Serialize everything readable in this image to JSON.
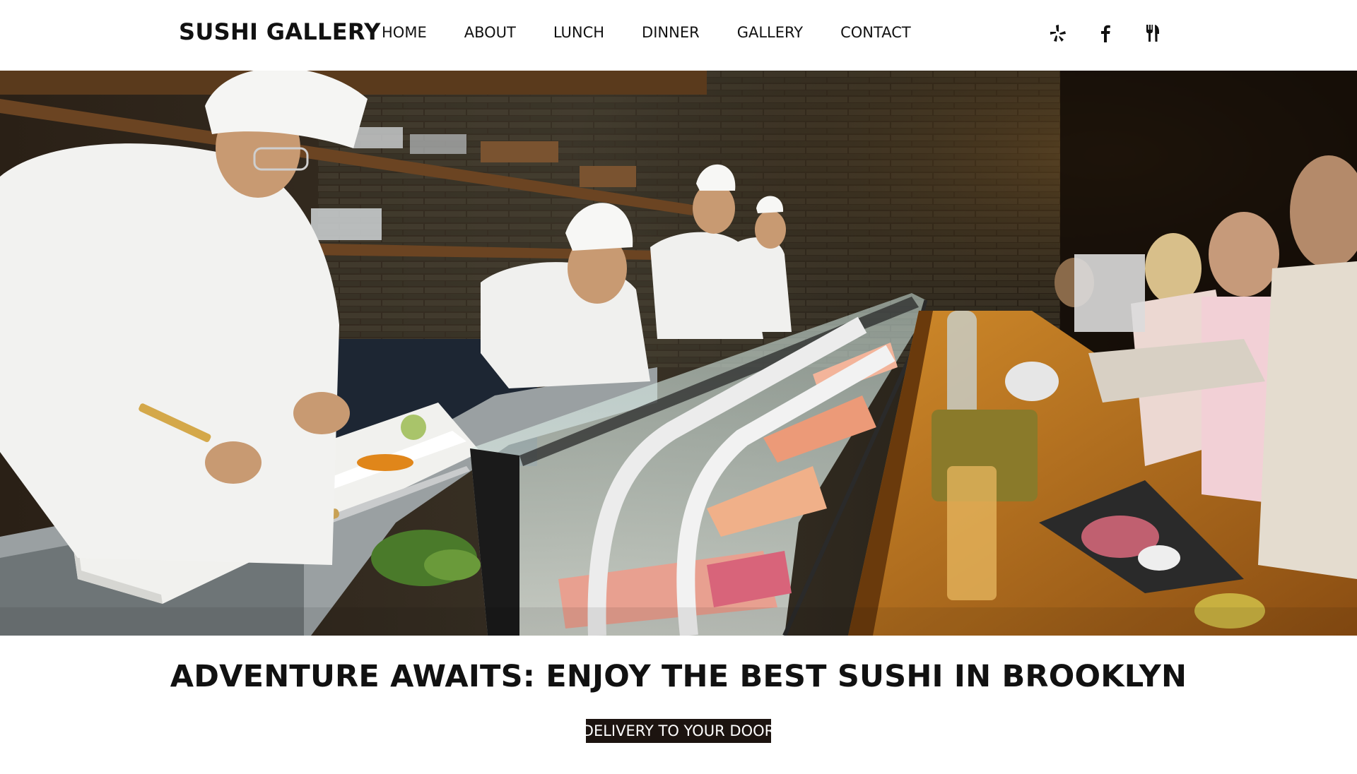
{
  "header": {
    "brand": "SUSHI GALLERY",
    "nav": [
      "HOME",
      "ABOUT",
      "LUNCH",
      "DINNER",
      "GALLERY",
      "CONTACT"
    ],
    "social_icons": [
      "yelp-icon",
      "facebook-icon",
      "fork-knife-icon"
    ]
  },
  "hero": {
    "image_subject": "sushi-bar-photo"
  },
  "main": {
    "headline": "ADVENTURE AWAITS: ENJOY THE BEST SUSHI IN BROOKLYN",
    "cta_label": "DELIVERY TO YOUR DOOR"
  },
  "colors": {
    "background": "#ffffff",
    "text": "#111111",
    "cta_background": "#1c1410",
    "cta_text": "#ffffff"
  }
}
